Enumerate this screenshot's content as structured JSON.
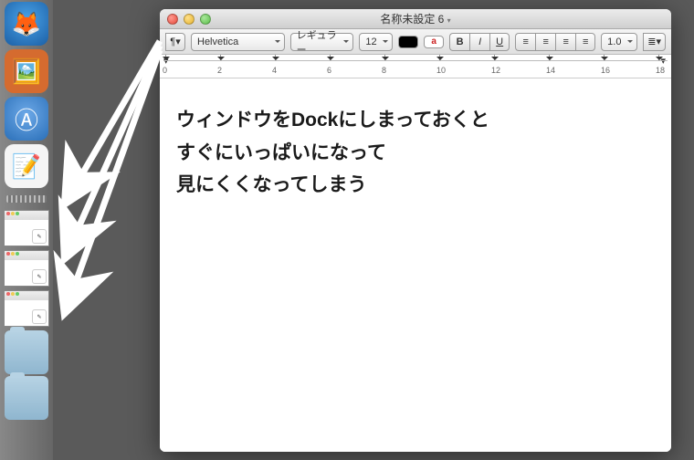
{
  "dock": {
    "apps": [
      {
        "name": "firefox",
        "emoji": "🦊",
        "bg": "radial-gradient(circle at 50% 40%,#4aa3e8,#1b5fa5)"
      },
      {
        "name": "image-app",
        "emoji": "🖼️",
        "bg": "#d56b2f"
      },
      {
        "name": "app-store",
        "emoji": "Ⓐ",
        "bg": "radial-gradient(circle at 50% 40%,#6da9e8,#2a6fb8)"
      },
      {
        "name": "textedit",
        "emoji": "📝",
        "bg": "#f5f5f5"
      }
    ]
  },
  "window": {
    "title": "名称未設定 6",
    "modified_indicator": "▾",
    "font_family": "Helvetica",
    "style": "レギュラー",
    "font_size": "12",
    "color_a": "a",
    "bold": "B",
    "italic": "I",
    "underline": "U",
    "spacing": "1.0",
    "align_icons": [
      "≡",
      "≡",
      "≡",
      "≡"
    ],
    "ruler_ticks": [
      "0",
      "2",
      "4",
      "6",
      "8",
      "10",
      "12",
      "14",
      "16",
      "18"
    ],
    "body": [
      "ウィンドウをDockにしまっておくと",
      "すぐにいっぱいになって",
      "見にくくなってしまう"
    ]
  }
}
